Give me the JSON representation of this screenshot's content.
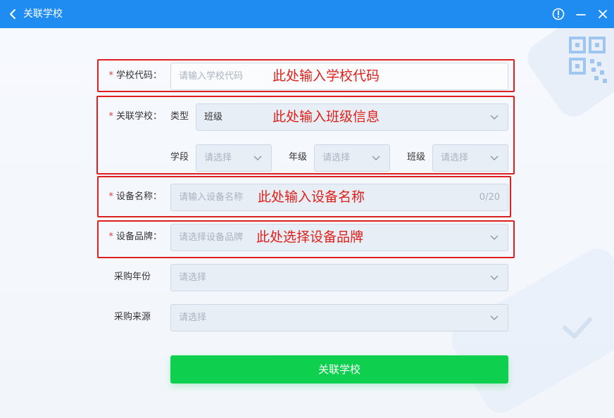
{
  "window": {
    "title": "关联学校"
  },
  "form": {
    "school_code": {
      "label": "学校代码：",
      "placeholder": "请输入学校代码",
      "annotation": "此处输入学校代码"
    },
    "link_school": {
      "label": "关联学校：",
      "type_label": "类型",
      "type_value": "班级",
      "annotation": "此处输入班级信息",
      "stage_label": "学段",
      "stage_placeholder": "请选择",
      "grade_label": "年级",
      "grade_placeholder": "请选择",
      "class_label": "班级",
      "class_placeholder": "请选择"
    },
    "device_name": {
      "label": "设备名称：",
      "placeholder": "请输入设备名称",
      "counter": "0/20",
      "annotation": "此处输入设备名称"
    },
    "device_brand": {
      "label": "设备品牌：",
      "placeholder": "请选择设备品牌",
      "annotation": "此处选择设备品牌"
    },
    "purchase_year": {
      "label": "采购年份",
      "placeholder": "请选择"
    },
    "purchase_source": {
      "label": "采购来源",
      "placeholder": "请选择"
    },
    "required_mark": "*",
    "submit_label": "关联学校"
  },
  "colors": {
    "titlebar": "#1f8cf2",
    "submit": "#0fd04e",
    "annotation": "#e0201a"
  }
}
